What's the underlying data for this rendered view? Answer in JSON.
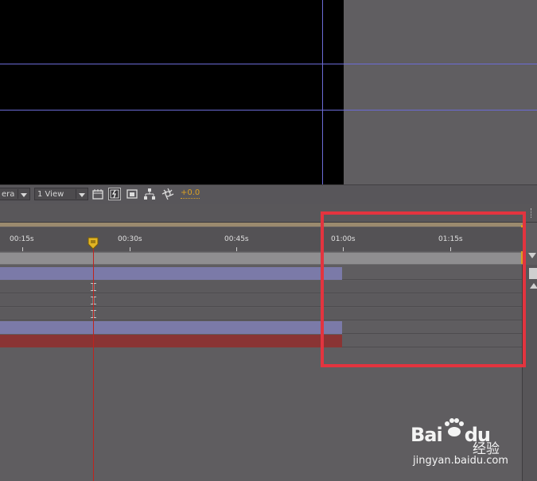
{
  "viewer": {
    "background": "#000000",
    "guide_color": "#6b6bd6"
  },
  "toolbar": {
    "camera_dropdown": "era",
    "view_dropdown": "1 View",
    "exposure_value": "+0.0",
    "icons": [
      "region-of-interest-icon",
      "transparency-grid-icon",
      "3d-view-icon",
      "flowchart-icon",
      "exposure-reset-icon"
    ]
  },
  "timeline": {
    "ruler_labels": [
      "00:15s",
      "00:30s",
      "00:45s",
      "01:00s",
      "01:15s"
    ],
    "layer_colors": {
      "purple": "#7b7aa8",
      "red": "#8a3434"
    },
    "highlight_color": "#e3343f"
  },
  "watermark": {
    "logo": "Bai",
    "logo_suffix": "du",
    "cn": "经验",
    "url": "jingyan.baidu.com"
  }
}
